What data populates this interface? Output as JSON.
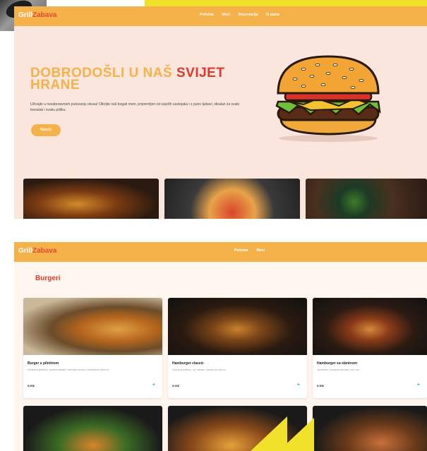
{
  "brand": {
    "part1": "Grill",
    "part2": "Zabava"
  },
  "screen1": {
    "nav": [
      "Početna",
      "Meni",
      "Rezervacija",
      "O nama"
    ],
    "hero_title": "DOBRODOŠLI U NAŠ",
    "hero_title_accent": "SVIJET",
    "hero_title_line2": "HRANE",
    "hero_desc": "Uživajte u nezaboravnom putovanju okusa! Otkrijte naš bogati meni, pripremljen od svježih sastojaka i s puno ljubavi, idealan za svaki trenutak i svaku priliku.",
    "hero_button": "Naruči"
  },
  "screen2": {
    "nav": [
      "Početna",
      "Meni"
    ],
    "section_title": "Burgeri",
    "cards": [
      {
        "name": "Burger s piletinom",
        "desc": "Hrskava piletina, svježa salata i domaći umak u mekanom pecivu.",
        "price": "5.00€",
        "add": "+"
      },
      {
        "name": "Hamburger classic",
        "desc": "Sočna junetina, sir, salata i umak po izboru.",
        "price": "5.00€",
        "add": "+"
      },
      {
        "name": "Hamburger sa slaninom",
        "desc": "Junetina, hrskava slanina, luk i sir.",
        "price": "5.50€",
        "add": "+"
      }
    ]
  },
  "colors": {
    "accent": "#f6b24a",
    "red": "#e0392b",
    "highlight": "#f1e12a"
  }
}
